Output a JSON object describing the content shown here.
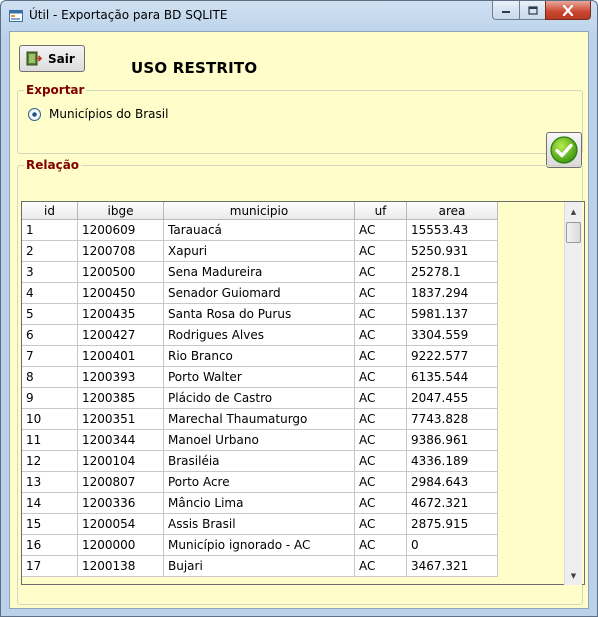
{
  "window": {
    "title": "Útil  - Exportação para BD SQLITE",
    "accent_close": "#c9462f"
  },
  "toolbar": {
    "sair_label": "Sair",
    "restrito_label": "USO RESTRITO"
  },
  "exportar": {
    "group_title": "Exportar",
    "option_label": "Municípios do Brasil",
    "option_checked": true
  },
  "relacao": {
    "group_title": "Relação",
    "columns": [
      "id",
      "ibge",
      "municipio",
      "uf",
      "area"
    ],
    "rows": [
      [
        "1",
        "1200609",
        "Tarauacá",
        "AC",
        "15553.43"
      ],
      [
        "2",
        "1200708",
        "Xapuri",
        "AC",
        "5250.931"
      ],
      [
        "3",
        "1200500",
        "Sena Madureira",
        "AC",
        "25278.1"
      ],
      [
        "4",
        "1200450",
        "Senador Guiomard",
        "AC",
        "1837.294"
      ],
      [
        "5",
        "1200435",
        "Santa Rosa do Purus",
        "AC",
        "5981.137"
      ],
      [
        "6",
        "1200427",
        "Rodrigues Alves",
        "AC",
        "3304.559"
      ],
      [
        "7",
        "1200401",
        "Rio Branco",
        "AC",
        "9222.577"
      ],
      [
        "8",
        "1200393",
        "Porto Walter",
        "AC",
        "6135.544"
      ],
      [
        "9",
        "1200385",
        "Plácido de Castro",
        "AC",
        "2047.455"
      ],
      [
        "10",
        "1200351",
        "Marechal Thaumaturgo",
        "AC",
        "7743.828"
      ],
      [
        "11",
        "1200344",
        "Manoel Urbano",
        "AC",
        "9386.961"
      ],
      [
        "12",
        "1200104",
        "Brasiléia",
        "AC",
        "4336.189"
      ],
      [
        "13",
        "1200807",
        "Porto Acre",
        "AC",
        "2984.643"
      ],
      [
        "14",
        "1200336",
        "Mâncio Lima",
        "AC",
        "4672.321"
      ],
      [
        "15",
        "1200054",
        "Assis Brasil",
        "AC",
        "2875.915"
      ],
      [
        "16",
        "1200000",
        "Município ignorado - AC",
        "AC",
        "0"
      ],
      [
        "17",
        "1200138",
        "Bujari",
        "AC",
        "3467.321"
      ]
    ]
  },
  "icons": {
    "app": "form-icon",
    "sair": "exit-door-icon",
    "ok": "green-check-icon"
  }
}
